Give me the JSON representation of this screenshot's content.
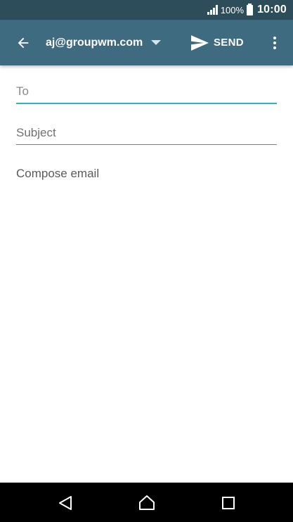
{
  "status_bar": {
    "battery_percent": "100%",
    "time": "10:00",
    "icons": [
      "signal-icon",
      "battery-icon"
    ]
  },
  "app_bar": {
    "back_icon": "back-arrow-icon",
    "account": "aj@groupwm.com",
    "account_dropdown_icon": "dropdown-caret-icon",
    "send_icon": "send-icon",
    "send_label": "SEND",
    "more_icon": "more-vert-icon"
  },
  "compose": {
    "to_placeholder": "To",
    "to_value": "",
    "subject_placeholder": "Subject",
    "subject_value": "",
    "body_placeholder": "Compose email",
    "body_value": ""
  },
  "colors": {
    "status_bar": "#2d4d5b",
    "app_bar": "#3e6b80",
    "focus_accent": "#2bb5c4",
    "nav_bar": "#000000"
  },
  "nav_bar": {
    "icons": [
      "nav-back-icon",
      "nav-home-icon",
      "nav-recents-icon"
    ]
  }
}
